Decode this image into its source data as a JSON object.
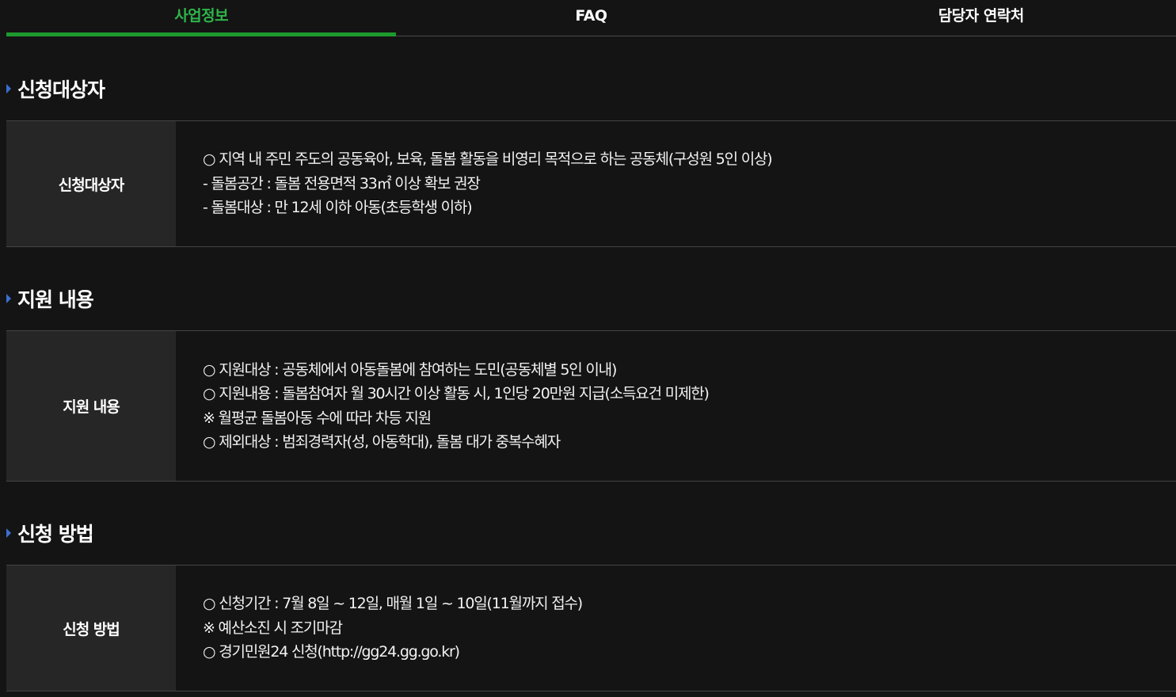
{
  "tabs": [
    {
      "label": "사업정보",
      "active": true
    },
    {
      "label": "FAQ",
      "active": false
    },
    {
      "label": "담당자 연락처",
      "active": false
    }
  ],
  "colors": {
    "background": "#141414",
    "accent": "#1d9a2e",
    "label_bg": "#262626",
    "title_arrow": "#3b6fd1"
  },
  "sections": [
    {
      "title": "신청대상자",
      "label": "신청대상자",
      "lines": [
        "○ 지역 내 주민 주도의 공동육아, 보육, 돌봄 활동을 비영리 목적으로 하는 공동체(구성원 5인 이상)",
        "- 돌봄공간 : 돌봄 전용면적 33㎡ 이상 확보 권장",
        "- 돌봄대상 : 만 12세 이하 아동(초등학생 이하)"
      ]
    },
    {
      "title": "지원 내용",
      "label": "지원 내용",
      "lines": [
        "○ 지원대상 : 공동체에서 아동돌봄에 참여하는 도민(공동체별 5인 이내)",
        "○ 지원내용 : 돌봄참여자 월 30시간 이상 활동 시, 1인당 20만원 지급(소득요건 미제한)",
        " ※ 월평균 돌봄아동 수에 따라 차등 지원",
        "○ 제외대상 : 범죄경력자(성, 아동학대), 돌봄 대가 중복수혜자"
      ]
    },
    {
      "title": "신청 방법",
      "label": "신청 방법",
      "lines": [
        "○ 신청기간 : 7월 8일 ~ 12일, 매월 1일 ~ 10일(11월까지 접수)",
        " ※ 예산소진 시 조기마감",
        "○ 경기민원24 신청(http://gg24.gg.go.kr)"
      ]
    }
  ]
}
